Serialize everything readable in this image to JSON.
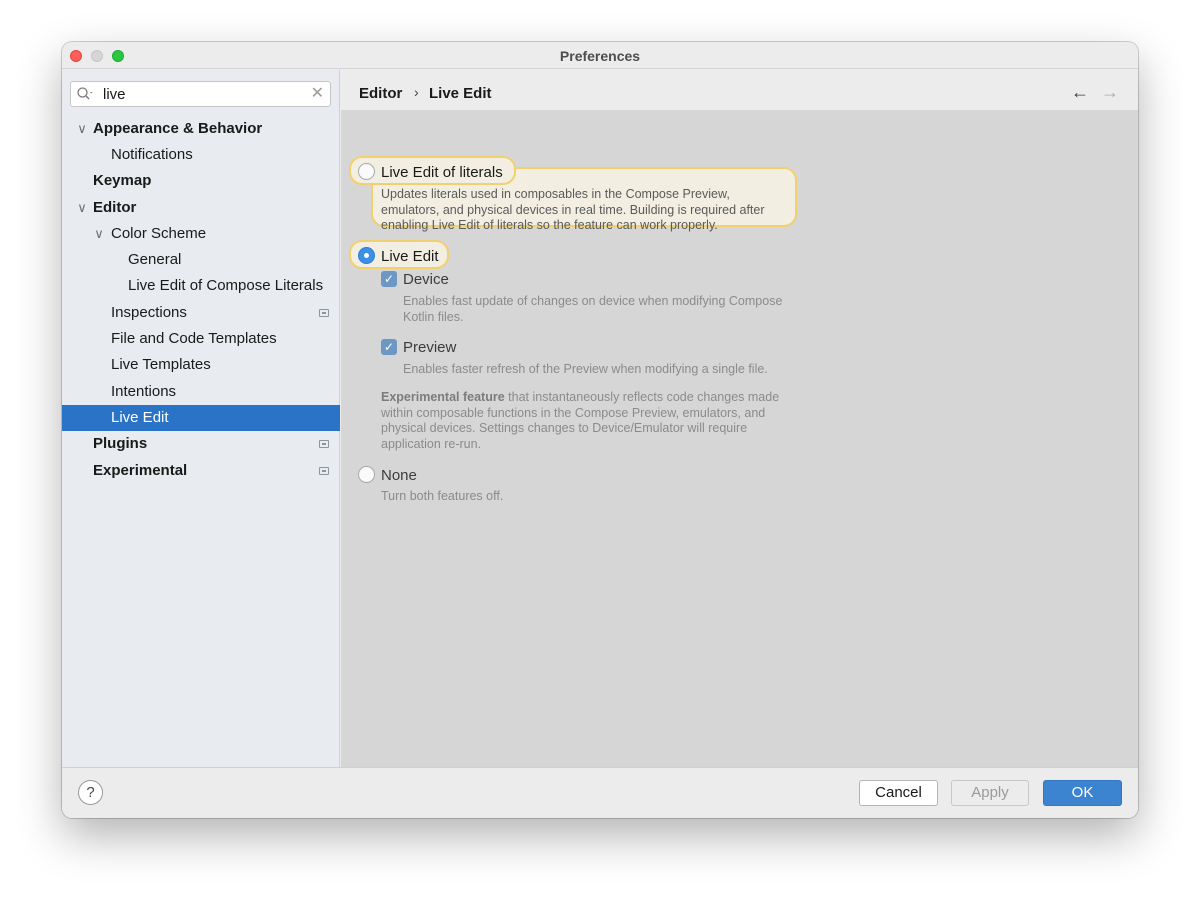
{
  "window": {
    "title": "Preferences"
  },
  "search": {
    "value": "live",
    "clear_icon": "clear-x-icon"
  },
  "sidebar": {
    "items": [
      {
        "label": "Appearance & Behavior",
        "bold": true,
        "expanded": true,
        "level": 0
      },
      {
        "label": "Notifications",
        "bold": false,
        "level": 1
      },
      {
        "label": "Keymap",
        "bold": true,
        "level": 0
      },
      {
        "label": "Editor",
        "bold": true,
        "expanded": true,
        "level": 0
      },
      {
        "label": "Color Scheme",
        "bold": false,
        "expanded": true,
        "level": 1
      },
      {
        "label": "General",
        "bold": false,
        "level": 2
      },
      {
        "label": "Live Edit of Compose Literals",
        "bold": false,
        "level": 2
      },
      {
        "label": "Inspections",
        "bold": false,
        "level": 1,
        "badge": "project-settings-icon"
      },
      {
        "label": "File and Code Templates",
        "bold": false,
        "level": 1
      },
      {
        "label": "Live Templates",
        "bold": false,
        "level": 1
      },
      {
        "label": "Intentions",
        "bold": false,
        "level": 1
      },
      {
        "label": "Live Edit",
        "bold": false,
        "level": 1,
        "selected": true
      },
      {
        "label": "Plugins",
        "bold": true,
        "level": 0,
        "badge": "project-settings-icon"
      },
      {
        "label": "Experimental",
        "bold": true,
        "level": 0,
        "badge": "project-settings-icon"
      }
    ]
  },
  "breadcrumb": {
    "parent": "Editor",
    "separator": "›",
    "current": "Live Edit",
    "back_icon": "arrow-left-icon",
    "forward_icon": "arrow-right-icon"
  },
  "options": {
    "literals": {
      "label": "Live Edit of literals",
      "selected": false,
      "description": "Updates literals used in composables in the Compose Preview, emulators, and physical devices in real time. Building is required after enabling Live Edit of literals so the feature can work properly."
    },
    "live_edit": {
      "label": "Live Edit",
      "selected": true,
      "device": {
        "label": "Device",
        "checked": true,
        "description": "Enables fast update of changes on device when modifying Compose Kotlin files."
      },
      "preview": {
        "label": "Preview",
        "checked": true,
        "description": "Enables faster refresh of the Preview when modifying a single file."
      },
      "experimental_bold": "Experimental feature",
      "experimental_rest": " that instantaneously reflects code changes made within composable functions in the Compose Preview, emulators, and physical devices. Settings changes to Device/Emulator will require application re-run."
    },
    "none": {
      "label": "None",
      "selected": false,
      "description": "Turn both features off."
    }
  },
  "footer": {
    "help": "?",
    "cancel": "Cancel",
    "apply": "Apply",
    "ok": "OK"
  },
  "colors": {
    "selection": "#2b73c7",
    "highlight_border": "#f0d070",
    "ok_button": "#3d84d0",
    "radio_on": "#3d8fe8"
  }
}
